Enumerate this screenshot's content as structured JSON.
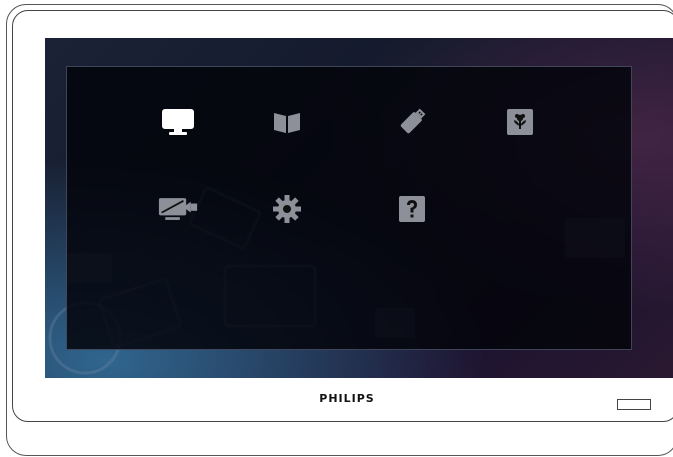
{
  "device": {
    "brand": "PHILIPS"
  },
  "colors": {
    "icon_selected": "#ffffff",
    "icon_normal": "#8e9099",
    "screen_bg": "#171c2e",
    "panel_bg": "#05060c"
  },
  "menu": {
    "selected_index": 0,
    "items": [
      {
        "icon": "monitor-icon"
      },
      {
        "icon": "book-icon"
      },
      {
        "icon": "usb-icon"
      },
      {
        "icon": "flower-icon"
      },
      {
        "icon": "display-input-icon"
      },
      {
        "icon": "gear-icon"
      },
      {
        "icon": "help-icon"
      }
    ]
  }
}
